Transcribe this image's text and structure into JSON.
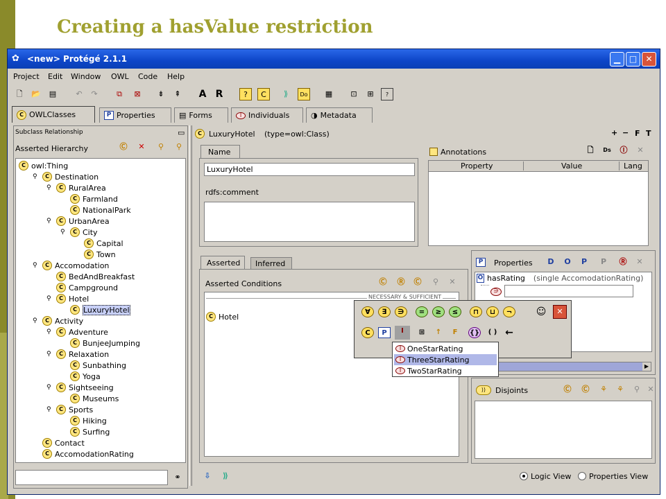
{
  "slide_title": "Creating a hasValue restriction",
  "window": {
    "title": "<new>  Protégé 2.1.1"
  },
  "menu": [
    "Project",
    "Edit",
    "Window",
    "OWL",
    "Code",
    "Help"
  ],
  "toolbar_text": {
    "a": "A",
    "r": "R"
  },
  "tabs": [
    "OWLClasses",
    "Properties",
    "Forms",
    "Individuals",
    "Metadata"
  ],
  "left": {
    "subtitle": "Subclass Relationship",
    "hierarchy_label": "Asserted Hierarchy",
    "tree": [
      {
        "label": "owl:Thing",
        "depth": 0
      },
      {
        "label": "Destination",
        "depth": 1
      },
      {
        "label": "RuralArea",
        "depth": 2
      },
      {
        "label": "Farmland",
        "depth": 3
      },
      {
        "label": "NationalPark",
        "depth": 3
      },
      {
        "label": "UrbanArea",
        "depth": 2
      },
      {
        "label": "City",
        "depth": 3
      },
      {
        "label": "Capital",
        "depth": 4
      },
      {
        "label": "Town",
        "depth": 4
      },
      {
        "label": "Accomodation",
        "depth": 1
      },
      {
        "label": "BedAndBreakfast",
        "depth": 2
      },
      {
        "label": "Campground",
        "depth": 2
      },
      {
        "label": "Hotel",
        "depth": 2
      },
      {
        "label": "LuxuryHotel",
        "depth": 3
      },
      {
        "label": "Activity",
        "depth": 1
      },
      {
        "label": "Adventure",
        "depth": 2
      },
      {
        "label": "BunjeeJumping",
        "depth": 3
      },
      {
        "label": "Relaxation",
        "depth": 2
      },
      {
        "label": "Sunbathing",
        "depth": 3
      },
      {
        "label": "Yoga",
        "depth": 3
      },
      {
        "label": "Sightseeing",
        "depth": 2
      },
      {
        "label": "Museums",
        "depth": 3
      },
      {
        "label": "Sports",
        "depth": 2
      },
      {
        "label": "Hiking",
        "depth": 3
      },
      {
        "label": "Surfing",
        "depth": 3
      },
      {
        "label": "Contact",
        "depth": 1
      },
      {
        "label": "AccomodationRating",
        "depth": 1
      }
    ],
    "selected": "LuxuryHotel",
    "search_value": ""
  },
  "class_header": {
    "name": "LuxuryHotel",
    "type": "(type=owl:Class)",
    "ops": [
      "+",
      "−",
      "F",
      "T"
    ]
  },
  "name_tab": "Name",
  "name_value": "LuxuryHotel",
  "comment_label": "rdfs:comment",
  "annotations": {
    "title": "Annotations",
    "columns": [
      "Property",
      "Value",
      "Lang"
    ]
  },
  "conditions": {
    "tabs": [
      "Asserted",
      "Inferred"
    ],
    "title": "Asserted Conditions",
    "section": "NECESSARY & SUFFICIENT",
    "rows": [
      "Hotel"
    ]
  },
  "properties_panel": {
    "title": "Properties",
    "property": "hasRating",
    "range": "(single AccomodationRating)"
  },
  "popup": {
    "row1_symbols": [
      "∀",
      "∃",
      "∋",
      "=",
      "≥",
      "≤",
      "⊓",
      "⊔",
      "¬"
    ],
    "row2_symbols": [
      "C",
      "P",
      "I",
      "⊞",
      "↑",
      "F",
      "{}",
      "( )",
      "←"
    ],
    "items": [
      "OneStarRating",
      "ThreeStarRating",
      "TwoStarRating"
    ],
    "highlighted": "ThreeStarRating"
  },
  "disjoints": {
    "title": "Disjoints"
  },
  "status": {
    "options": [
      "Logic View",
      "Properties View"
    ],
    "selected": "Logic View"
  }
}
